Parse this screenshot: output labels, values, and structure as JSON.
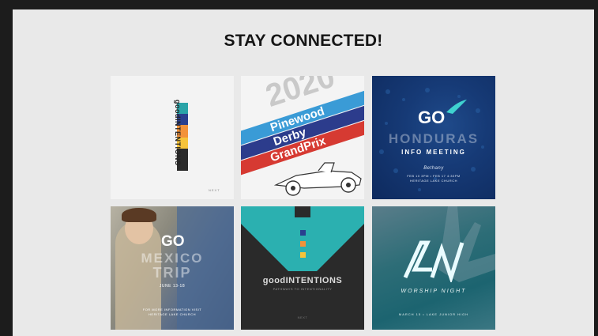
{
  "page": {
    "title": "STAY CONNECTED!"
  },
  "tiles": {
    "good_intentions_1": {
      "vertical_text": "goodINTENTIONS",
      "footer": "NEXT"
    },
    "pinewood": {
      "year": "2020",
      "line1": "Pinewood",
      "line2": "Derby",
      "line3": "GrandPrix"
    },
    "honduras": {
      "brand": "GO",
      "headline": "HONDURAS",
      "subtitle": "INFO MEETING",
      "script": "Bethany",
      "details1": "FEB 10 3PM • FEB 17 4:30PM",
      "details2": "HERITAGE LAKE CHURCH"
    },
    "mexico": {
      "brand": "GO",
      "headline": "MEXICO",
      "sub": "TRIP",
      "dates": "JUNE 13-18",
      "details1": "FOR MORE INFORMATION VISIT",
      "details2": "HERITAGE LAKE CHURCH"
    },
    "good_intentions_2": {
      "title": "goodINTENTIONS",
      "tagline": "PATHWAYS TO INTENTIONALITY",
      "footer": "NEXT"
    },
    "worship": {
      "title": "WORSHIP NIGHT",
      "details": "MARCH 15 • LAKE JUNIOR HIGH"
    }
  },
  "colors": {
    "frame_bg": "#e9e9e9",
    "outer_bg": "#1c1c1c",
    "swatch_teal": "#2aa4a8",
    "swatch_navy": "#2a3f8f",
    "swatch_orange": "#f3923a",
    "swatch_yellow": "#f6c33a",
    "swatch_dark": "#2a2a2a",
    "stripe_blue": "#3a9bd6",
    "stripe_navy": "#2c3c8c",
    "stripe_red": "#d63a32",
    "teal_v": "#2bb0b0"
  }
}
